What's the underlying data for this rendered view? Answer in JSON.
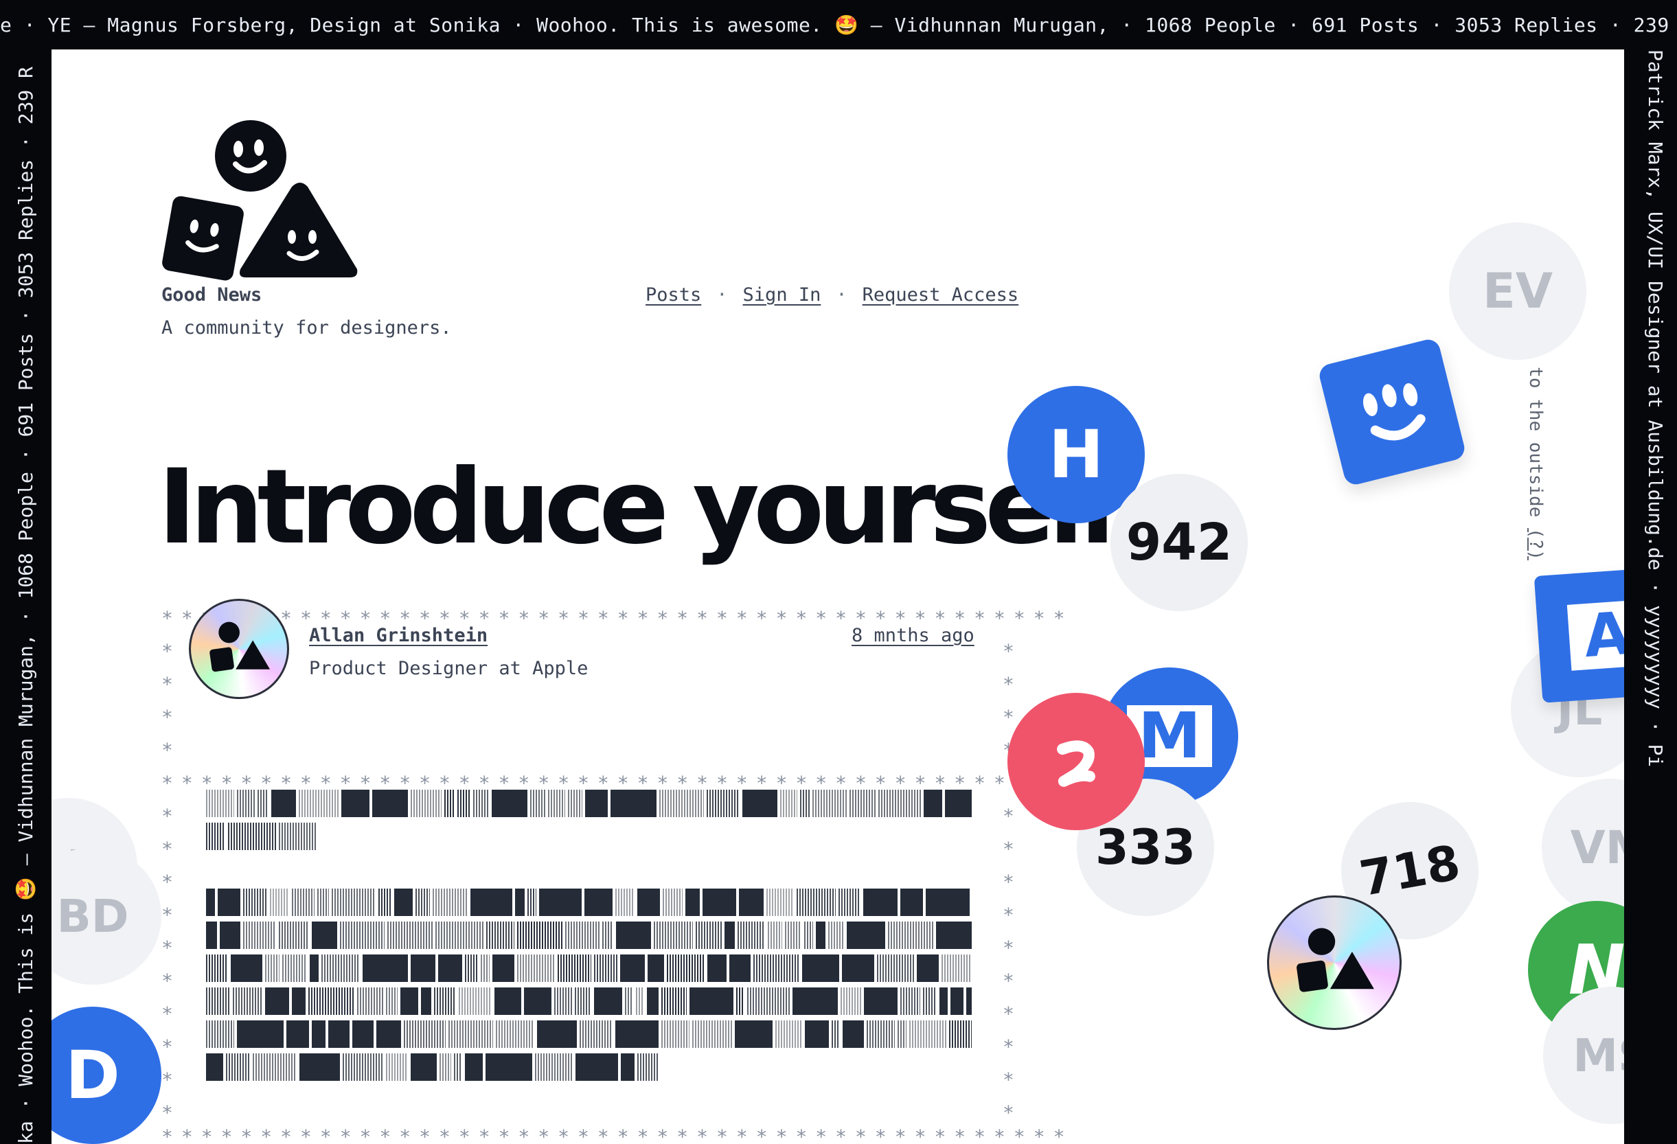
{
  "ribbon": {
    "top": "e · YE — Magnus Forsberg, Design at Sonika · Woohoo. This is awesome. 🤩 — Vidhunnan Murugan, · 1068 People · 691 Posts · 3053 Replies · 239 Ribbon Messages ·",
    "left": "ka · Woohoo. This is 🤩 — Vidhunnan Murugan, · 1068 People · 691 Posts · 3053 Replies · 239 R",
    "right": "Patrick Marx, UX/UI Designer at Ausbildung.de · yyyyyyyyy · Pi"
  },
  "site": {
    "name": "Good News",
    "tagline": "A community for designers."
  },
  "nav": {
    "posts": "Posts",
    "sign_in": "Sign In",
    "request_access": "Request Access",
    "separator": "·"
  },
  "headline": "Introduce yourself.",
  "post": {
    "author": "Allan Grinshtein",
    "role": "Product Designer at Apple",
    "time": "8 mnths ago"
  },
  "bubbles": {
    "h": "H",
    "n942": "942",
    "a": "A",
    "m": "M",
    "n333": "333",
    "n718": "718",
    "ev": "EV",
    "jl": "JL",
    "vm": "VM",
    "n_green": "N",
    "ms": "MS",
    "m_left": "M",
    "bd": "BD",
    "d": "D"
  },
  "side_note": {
    "text": "Unreadable to the outside",
    "link": "(?)"
  },
  "colors": {
    "background": "#05070b",
    "page": "#ffffff",
    "blue": "#2f6fe6",
    "red": "#f0546b",
    "green": "#3bab4d",
    "text": "#3c4455"
  },
  "icons": [
    "good-news-logo-icon",
    "smiley-square-icon",
    "holographic-avatar-icon"
  ]
}
